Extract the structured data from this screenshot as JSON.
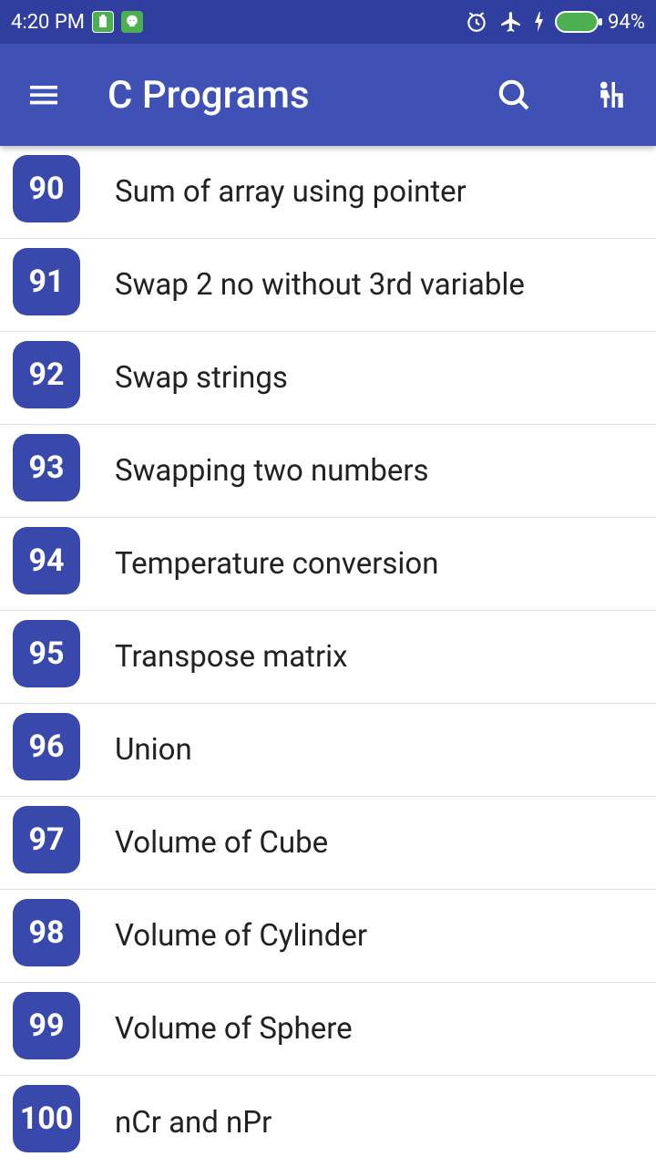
{
  "status": {
    "time": "4:20 PM",
    "battery_pct": "94%"
  },
  "header": {
    "title": "C Programs"
  },
  "list": {
    "items": [
      {
        "num": "90",
        "label": "Sum of array using pointer"
      },
      {
        "num": "91",
        "label": "Swap 2 no without 3rd variable"
      },
      {
        "num": "92",
        "label": "Swap strings"
      },
      {
        "num": "93",
        "label": "Swapping two numbers"
      },
      {
        "num": "94",
        "label": "Temperature conversion"
      },
      {
        "num": "95",
        "label": "Transpose matrix"
      },
      {
        "num": "96",
        "label": "Union"
      },
      {
        "num": "97",
        "label": "Volume of Cube"
      },
      {
        "num": "98",
        "label": "Volume of Cylinder"
      },
      {
        "num": "99",
        "label": "Volume of Sphere"
      },
      {
        "num": "100",
        "label": "nCr and nPr"
      }
    ]
  }
}
